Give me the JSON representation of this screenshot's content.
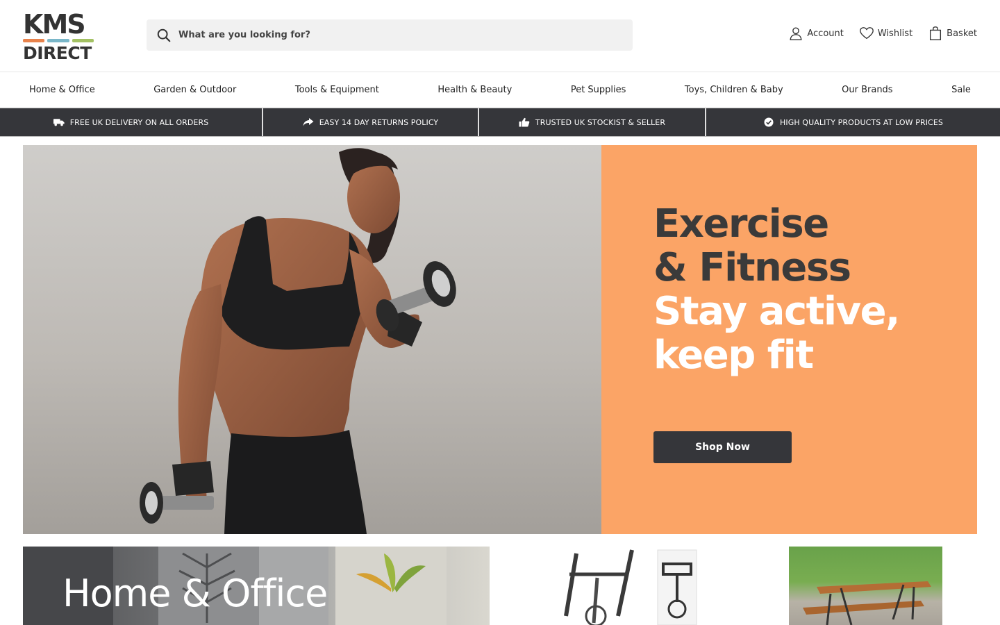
{
  "brand": {
    "line1": "KMS",
    "line2": "DIRECT",
    "stripe_colors": [
      "#e8834c",
      "#7ab7c9",
      "#a3c163"
    ]
  },
  "search": {
    "placeholder": "What are you looking for?",
    "value": ""
  },
  "utils": [
    {
      "label": "Account",
      "icon": "user-icon"
    },
    {
      "label": "Wishlist",
      "icon": "heart-icon"
    },
    {
      "label": "Basket",
      "icon": "basket-icon"
    }
  ],
  "nav": [
    "Home & Office",
    "Garden & Outdoor",
    "Tools & Equipment",
    "Health & Beauty",
    "Pet Supplies",
    "Toys, Children & Baby",
    "Our Brands",
    "Sale"
  ],
  "usp": [
    {
      "text": "FREE UK DELIVERY ON ALL ORDERS",
      "icon": "truck-icon"
    },
    {
      "text": "EASY 14 DAY RETURNS POLICY",
      "icon": "share-arrow-icon"
    },
    {
      "text": "TRUSTED UK STOCKIST & SELLER",
      "icon": "thumbs-up-icon"
    },
    {
      "text": "HIGH QUALITY PRODUCTS AT LOW PRICES",
      "icon": "check-circle-icon"
    }
  ],
  "hero": {
    "title_line1": "Exercise",
    "title_line2": "& Fitness",
    "sub_line1": "Stay active,",
    "sub_line2": "keep fit",
    "button": "Shop Now",
    "panel_color": "#fba466"
  },
  "tiles": {
    "home_title": "Home & Office"
  },
  "colors": {
    "dark": "#35363a",
    "text": "#333333"
  }
}
